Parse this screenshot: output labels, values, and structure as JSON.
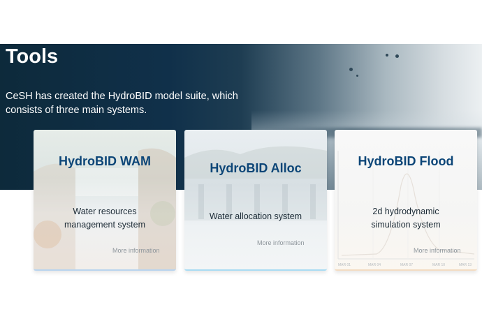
{
  "page": {
    "title": "Tools",
    "intro": "CeSH has created the HydroBID model suite, which consists of three main systems."
  },
  "cards": [
    {
      "title": "HydroBID WAM",
      "description_lines": [
        "Water resources",
        "management system"
      ],
      "link": "More information",
      "accent_color": "#b9d4ee"
    },
    {
      "title": "HydroBID Alloc",
      "description_lines": [
        "Water allocation system"
      ],
      "link": "More information",
      "accent_color": "#a9dcf3"
    },
    {
      "title": "HydroBID Flood",
      "description_lines": [
        "2d hydrodynamic",
        "simulation system"
      ],
      "link": "More information",
      "accent_color": "#f3dcc2"
    }
  ],
  "flood_chart_axis": [
    "MAR 01",
    "MAR 04",
    "MAR 07",
    "MAR 10",
    "MAR 13"
  ],
  "colors": {
    "hero_dark": "#0d2a3b",
    "card_title": "#0c4577"
  }
}
